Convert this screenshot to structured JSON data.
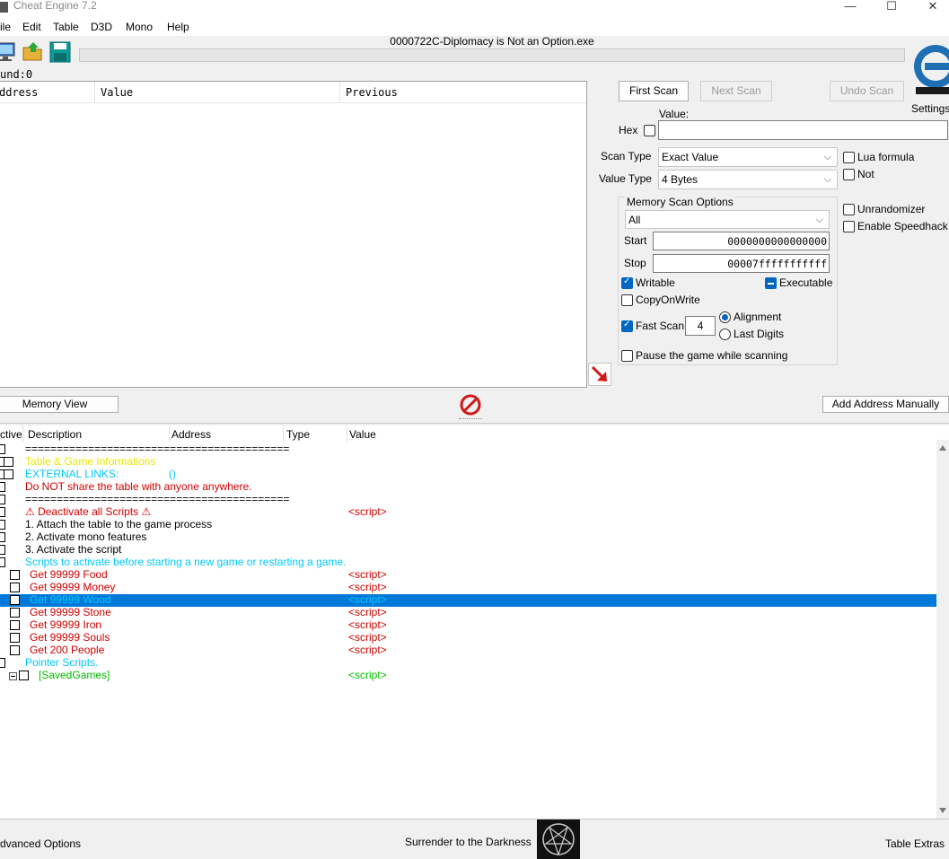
{
  "window": {
    "title": "Cheat Engine 7.2",
    "minimize": "—",
    "maximize": "☐",
    "close": "✕"
  },
  "menu": [
    "ile",
    "Edit",
    "Table",
    "D3D",
    "Mono",
    "Help"
  ],
  "process_title": "0000722C-Diplomacy is Not an Option.exe",
  "found_label": "und:0",
  "results": {
    "headers": [
      "ddress",
      "Value",
      "Previous"
    ]
  },
  "scan": {
    "first_scan": "First Scan",
    "next_scan": "Next Scan",
    "undo_scan": "Undo Scan",
    "settings": "Settings",
    "value_label": "Value:",
    "hex_label": "Hex",
    "scan_type_label": "Scan Type",
    "scan_type_value": "Exact Value",
    "value_type_label": "Value Type",
    "value_type_value": "4 Bytes",
    "lua_formula": "Lua formula",
    "not": "Not",
    "unrandomizer": "Unrandomizer",
    "enable_speedhack": "Enable Speedhack",
    "memory_scan_options": "Memory Scan Options",
    "region": "All",
    "start_label": "Start",
    "start_value": "0000000000000000",
    "stop_label": "Stop",
    "stop_value": "00007fffffffffff",
    "writable": "Writable",
    "executable": "Executable",
    "copy_on_write": "CopyOnWrite",
    "fast_scan": "Fast Scan",
    "fast_scan_value": "4",
    "alignment": "Alignment",
    "last_digits": "Last Digits",
    "pause_game": "Pause the game while scanning"
  },
  "buttons": {
    "memory_view": "Memory View",
    "add_address": "Add Address Manually"
  },
  "cheat_table": {
    "headers": [
      "ctive",
      "Description",
      "Address",
      "Type",
      "Value"
    ],
    "rows": [
      {
        "desc": "==========================================",
        "value": "",
        "color": "#000000"
      },
      {
        "desc": "Table & Game Informations",
        "value": "",
        "color": "#e8e800"
      },
      {
        "desc": "EXTERNAL LINKS:",
        "extra": "()",
        "value": "",
        "color": "#00c8ff"
      },
      {
        "desc": "Do NOT share the table with anyone anywhere.",
        "value": "",
        "color": "#d00000"
      },
      {
        "desc": "==========================================",
        "value": "",
        "color": "#000000"
      },
      {
        "desc": "⚠ Deactivate all Scripts ⚠",
        "value": "<script>",
        "color": "#d00000"
      },
      {
        "desc": "1. Attach the table to the game process",
        "value": "",
        "color": "#000000"
      },
      {
        "desc": "2. Activate mono features",
        "value": "",
        "color": "#000000"
      },
      {
        "desc": "3. Activate the script",
        "value": "",
        "color": "#000000"
      },
      {
        "desc": "Scripts to activate before starting a new game or restarting a game.",
        "value": "",
        "color": "#00c8ff"
      },
      {
        "desc": "Get 99999 Food",
        "value": "<script>",
        "color": "#d00000"
      },
      {
        "desc": "Get 99999 Money",
        "value": "<script>",
        "color": "#d00000"
      },
      {
        "desc": "Get 99999 Wood",
        "value": "<script>",
        "color": "#00c8ff"
      },
      {
        "desc": "Get 99999 Stone",
        "value": "<script>",
        "color": "#d00000"
      },
      {
        "desc": "Get 99999 Iron",
        "value": "<script>",
        "color": "#d00000"
      },
      {
        "desc": "Get 99999 Souls",
        "value": "<script>",
        "color": "#d00000"
      },
      {
        "desc": "Get 200 People",
        "value": "<script>",
        "color": "#d00000"
      },
      {
        "desc": "Pointer Scripts.",
        "value": "",
        "color": "#00c8ff"
      },
      {
        "desc": "[SavedGames]",
        "value": "<script>",
        "color": "#00c000"
      }
    ]
  },
  "status": {
    "advanced_options": "dvanced Options",
    "tagline": "Surrender to the Darkness",
    "table_extras": "Table Extras"
  }
}
